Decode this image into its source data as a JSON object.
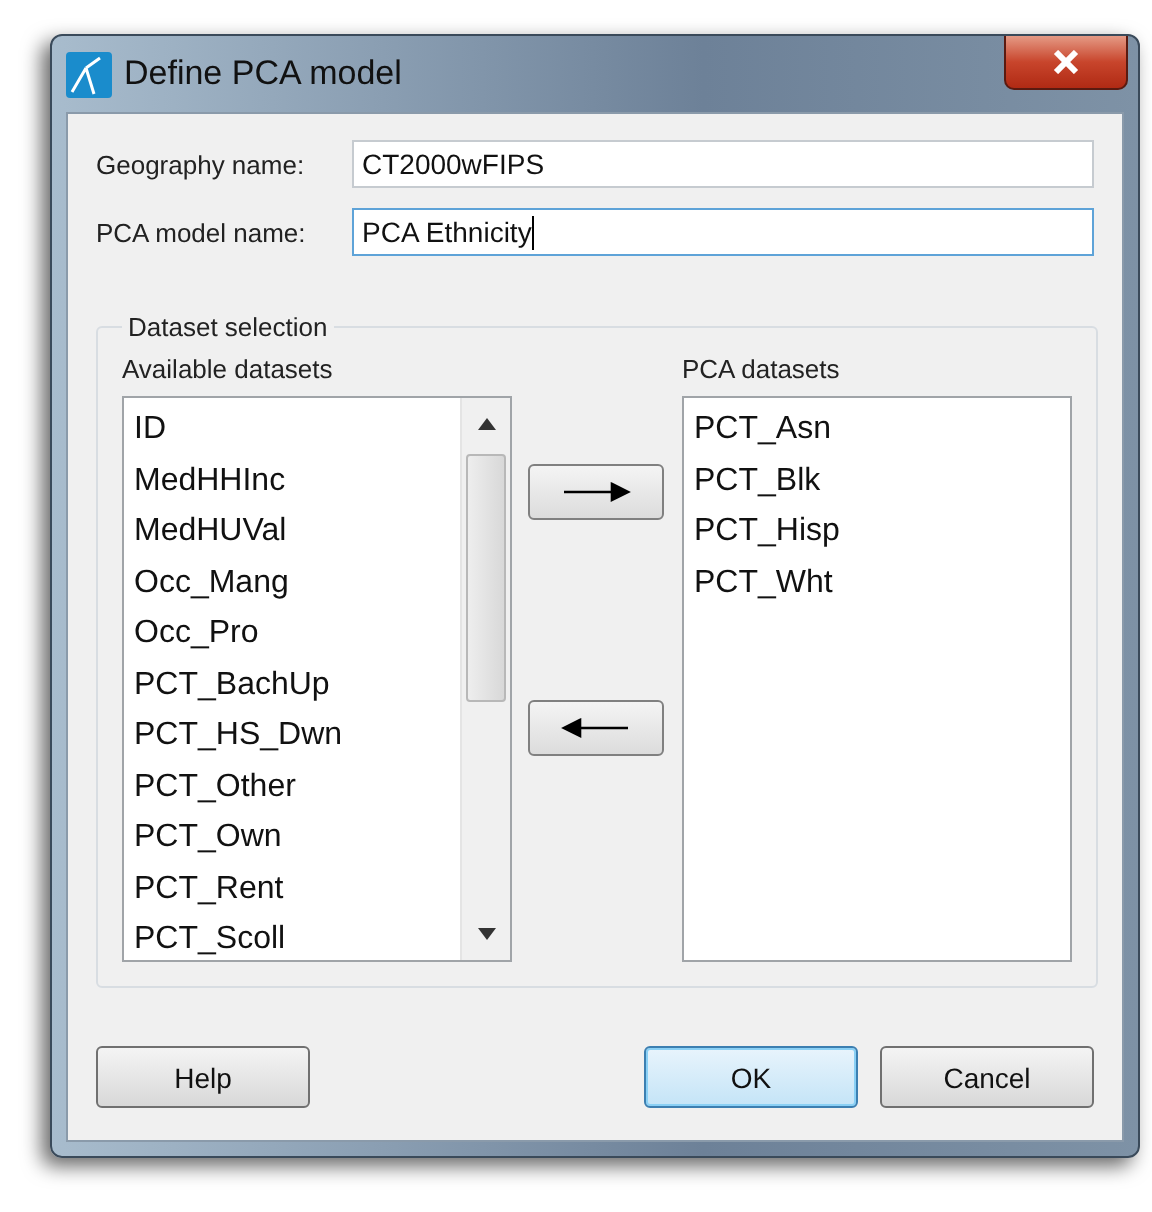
{
  "window": {
    "title": "Define PCA model"
  },
  "fields": [
    {
      "label": "Geography name:",
      "value": "CT2000wFIPS",
      "focused": false
    },
    {
      "label": "PCA model name:",
      "value": "PCA Ethnicity",
      "focused": true
    }
  ],
  "dataset_selection": {
    "title": "Dataset selection",
    "available": {
      "label": "Available datasets",
      "items": [
        "ID",
        "MedHHInc",
        "MedHUVal",
        "Occ_Mang",
        "Occ_Pro",
        "PCT_BachUp",
        "PCT_HS_Dwn",
        "PCT_Other",
        "PCT_Own",
        "PCT_Rent",
        "PCT_Scoll"
      ]
    },
    "move_buttons": [
      {
        "kind": "right"
      },
      {
        "kind": "left"
      }
    ],
    "selected": {
      "label": "PCA datasets",
      "items": [
        "PCT_Asn",
        "PCT_Blk",
        "PCT_Hisp",
        "PCT_Wht"
      ]
    }
  },
  "buttons": [
    {
      "label": "Help",
      "default": false
    },
    {
      "label": "OK",
      "default": true
    },
    {
      "label": "Cancel",
      "default": false
    }
  ]
}
